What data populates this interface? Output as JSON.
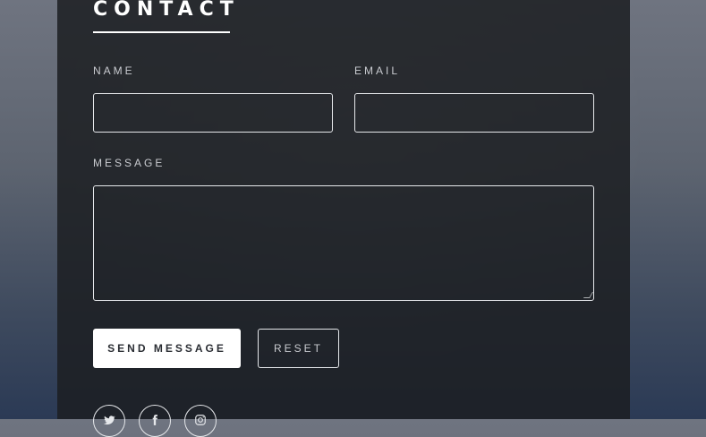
{
  "contact": {
    "title": "CONTACT",
    "fields": {
      "name": {
        "label": "NAME",
        "value": ""
      },
      "email": {
        "label": "EMAIL",
        "value": ""
      },
      "message": {
        "label": "MESSAGE",
        "value": ""
      }
    },
    "buttons": {
      "send_label": "SEND MESSAGE",
      "reset_label": "RESET"
    },
    "social": [
      {
        "icon": "twitter-icon"
      },
      {
        "icon": "facebook-icon"
      },
      {
        "icon": "instagram-icon"
      }
    ]
  },
  "colors": {
    "panel": "#1c1e22",
    "text": "#ffffff",
    "muted": "#c9cbd0",
    "border": "#e6e8eb"
  }
}
